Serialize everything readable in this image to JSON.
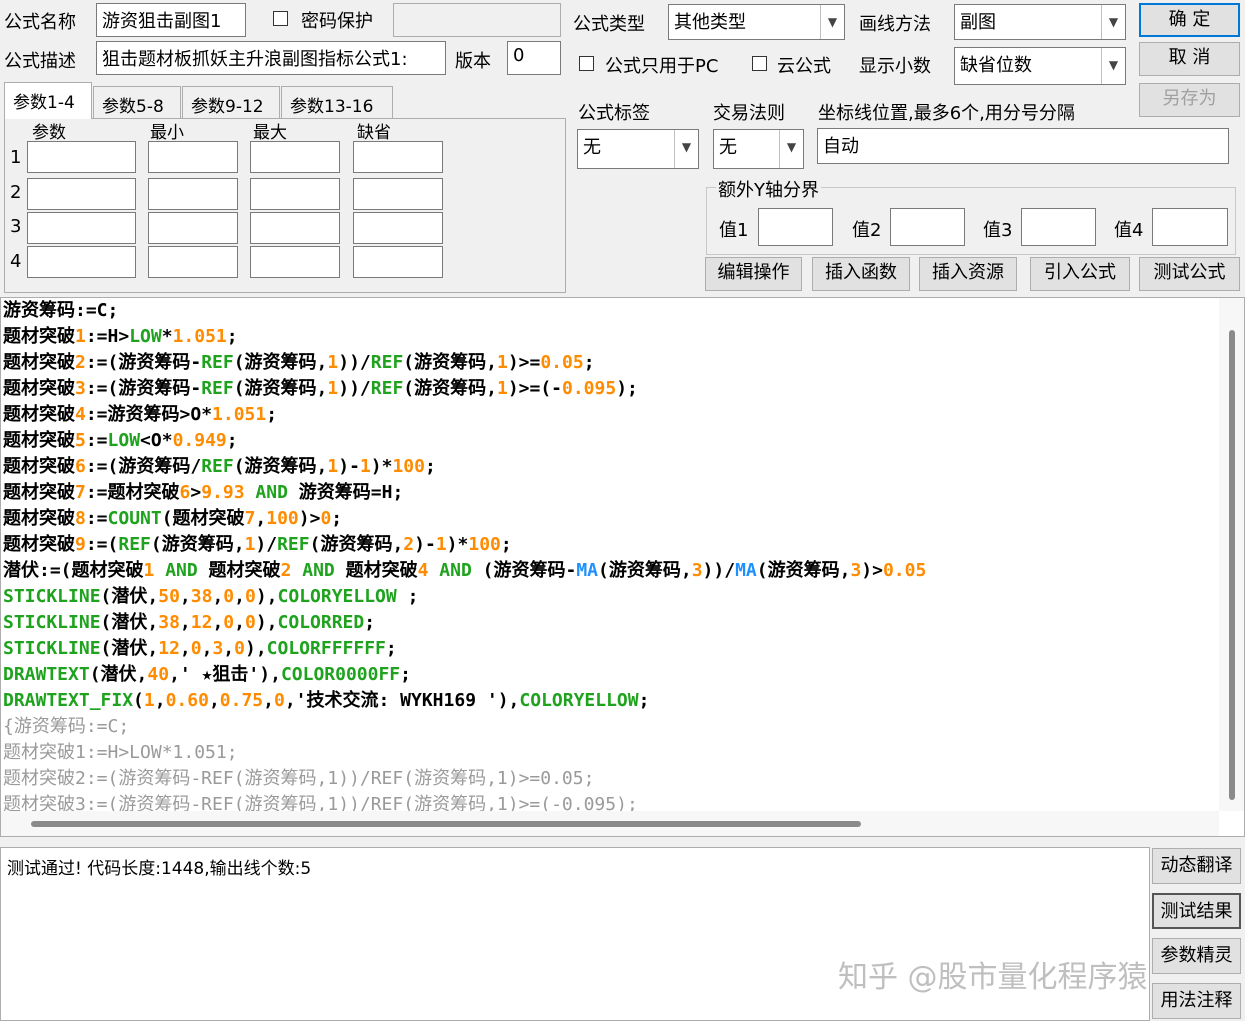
{
  "form": {
    "name_label": "公式名称",
    "name_value": "游资狙击副图1",
    "password_label": "密码保护",
    "desc_label": "公式描述",
    "desc_value": "狙击题材板抓妖主升浪副图指标公式1:",
    "version_label": "版本",
    "version_value": "0",
    "type_label": "公式类型",
    "type_value": "其他类型",
    "draw_label": "画线方法",
    "draw_value": "副图",
    "pc_only_label": "公式只用于PC",
    "cloud_label": "云公式",
    "decimal_label": "显示小数",
    "decimal_value": "缺省位数",
    "tag_label": "公式标签",
    "tag_value": "无",
    "rule_label": "交易法则",
    "rule_value": "无",
    "axis_label": "坐标线位置,最多6个,用分号分隔",
    "axis_value": "自动",
    "extra_y_label": "额外Y轴分界",
    "val1": "值1",
    "val2": "值2",
    "val3": "值3",
    "val4": "值4"
  },
  "buttons": {
    "ok": "确  定",
    "cancel": "取  消",
    "save_as": "另存为",
    "edit_ops": "编辑操作",
    "insert_fn": "插入函数",
    "insert_res": "插入资源",
    "import_formula": "引入公式",
    "test_formula": "测试公式",
    "dyn_translate": "动态翻译",
    "test_result": "测试结果",
    "param_wizard": "参数精灵",
    "usage_notes": "用法注释"
  },
  "tabs": [
    "参数1-4",
    "参数5-8",
    "参数9-12",
    "参数13-16"
  ],
  "param_headers": [
    "参数",
    "最小",
    "最大",
    "缺省"
  ],
  "param_rows": [
    "1",
    "2",
    "3",
    "4"
  ],
  "status_text": "测试通过! 代码长度:1448,输出线个数:5",
  "watermark": "知乎 @股市量化程序猿",
  "code_lines": [
    "游资筹码:=C;",
    "题材突破1:=H>LOW*1.051;",
    "题材突破2:=(游资筹码-REF(游资筹码,1))/REF(游资筹码,1)>=0.05;",
    "题材突破3:=(游资筹码-REF(游资筹码,1))/REF(游资筹码,1)>=(-0.095);",
    "题材突破4:=游资筹码>O*1.051;",
    "题材突破5:=LOW<O*0.949;",
    "题材突破6:=(游资筹码/REF(游资筹码,1)-1)*100;",
    "题材突破7:=题材突破6>9.93 AND 游资筹码=H;",
    "题材突破8:=COUNT(题材突破7,100)>0;",
    "题材突破9:=(REF(游资筹码,1)/REF(游资筹码,2)-1)*100;",
    "潜伏:=(题材突破1 AND 题材突破2 AND 题材突破4 AND (游资筹码-MA(游资筹码,3))/MA(游资筹码,3)>0.05",
    "STICKLINE(潜伏,50,38,0,0),COLORYELLOW ;",
    "STICKLINE(潜伏,38,12,0,0),COLORRED;",
    "STICKLINE(潜伏,12,0,3,0),COLORFFFFFF;",
    "DRAWTEXT(潜伏,40,' ★狙击'),COLOR0000FF;",
    "DRAWTEXT_FIX(1,0.60,0.75,0,'技术交流: WYKH169 '),COLORYELLOW;",
    "{游资筹码:=C;",
    "题材突破1:=H>LOW*1.051;",
    "题材突破2:=(游资筹码-REF(游资筹码,1))/REF(游资筹码,1)>=0.05;",
    "题材突破3:=(游资筹码-REF(游资筹码,1))/REF(游资筹码,1)>=(-0.095);"
  ],
  "dim_from_line": 16,
  "colors": {
    "number": "#ff8c00",
    "function": "#1fa31f",
    "ma": "#1e90ff",
    "accent_border": "#0078d7"
  }
}
